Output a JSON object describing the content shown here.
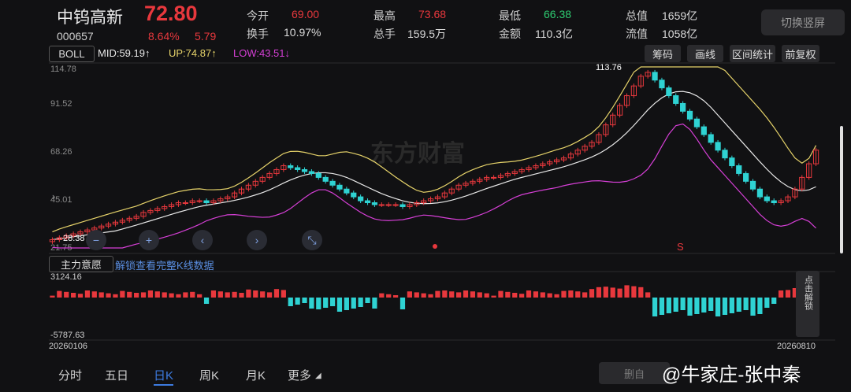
{
  "header": {
    "stock_name": "中钨高新",
    "price": "72.80",
    "code": "000657",
    "change_pct": "8.64%",
    "change_abs": "5.79",
    "stats": [
      {
        "label": "今开",
        "value": "69.00",
        "color": "red"
      },
      {
        "label": "换手",
        "value": "10.97%",
        "color": "white"
      },
      {
        "label": "最高",
        "value": "73.68",
        "color": "red"
      },
      {
        "label": "总手",
        "value": "159.5万",
        "color": "white"
      },
      {
        "label": "最低",
        "value": "66.38",
        "color": "green"
      },
      {
        "label": "金额",
        "value": "110.3亿",
        "color": "white"
      },
      {
        "label": "总值",
        "value": "1659亿",
        "color": "white"
      },
      {
        "label": "流值",
        "value": "1058亿",
        "color": "white"
      }
    ],
    "switch_label": "切换竖屏"
  },
  "indicator": {
    "selector": "BOLL",
    "mid": "MID:59.19↑",
    "up": "UP:74.87↑",
    "low": "LOW:43.51↓",
    "mid_color": "#e8e8e8",
    "up_color": "#e6d36a",
    "low_color": "#d63fd6"
  },
  "tools": [
    "筹码",
    "画线",
    "区间统计",
    "前复权"
  ],
  "price_axis": [
    "114.78",
    "91.52",
    "68.26",
    "45.01",
    "21.75"
  ],
  "annotations": {
    "high_marker": "113.76",
    "low_marker": "28.38",
    "sell_signal": "S"
  },
  "sub_panel": {
    "selector": "主力意愿",
    "unlock_text": "解锁查看完整K线数据",
    "max_label": "3124.16",
    "min_label": "-5787.63",
    "side_unlock": "点击解锁"
  },
  "dates": {
    "start": "20260106",
    "end": "20260810"
  },
  "tabs": [
    "分时",
    "五日",
    "日K",
    "周K",
    "月K",
    "更多"
  ],
  "active_tab": "日K",
  "bottom_button": "删自",
  "watermark": "@牛家庄-张中秦",
  "chart_data": {
    "type": "candlestick",
    "ylim": [
      21.75,
      114.78
    ],
    "y_ticks": [
      114.78,
      91.52,
      68.26,
      45.01,
      21.75
    ],
    "close_series": [
      26,
      27,
      28,
      29,
      30,
      31,
      32,
      33,
      34,
      35,
      36,
      37,
      38,
      40,
      41,
      42,
      43,
      44,
      45,
      45,
      46,
      46,
      45,
      46,
      47,
      48,
      50,
      52,
      54,
      56,
      58,
      60,
      62,
      64,
      63,
      62,
      61,
      60,
      58,
      56,
      54,
      52,
      50,
      48,
      46,
      45,
      44,
      44,
      44,
      44,
      43,
      44,
      45,
      46,
      47,
      48,
      50,
      52,
      54,
      55,
      56,
      57,
      58,
      58,
      59,
      60,
      61,
      62,
      63,
      64,
      65,
      66,
      67,
      68,
      70,
      72,
      74,
      76,
      80,
      85,
      90,
      95,
      100,
      105,
      110,
      112,
      108,
      104,
      100,
      96,
      92,
      88,
      84,
      80,
      76,
      72,
      68,
      64,
      60,
      56,
      52,
      48,
      46,
      45,
      46,
      48,
      52,
      58,
      65,
      72
    ]
  }
}
